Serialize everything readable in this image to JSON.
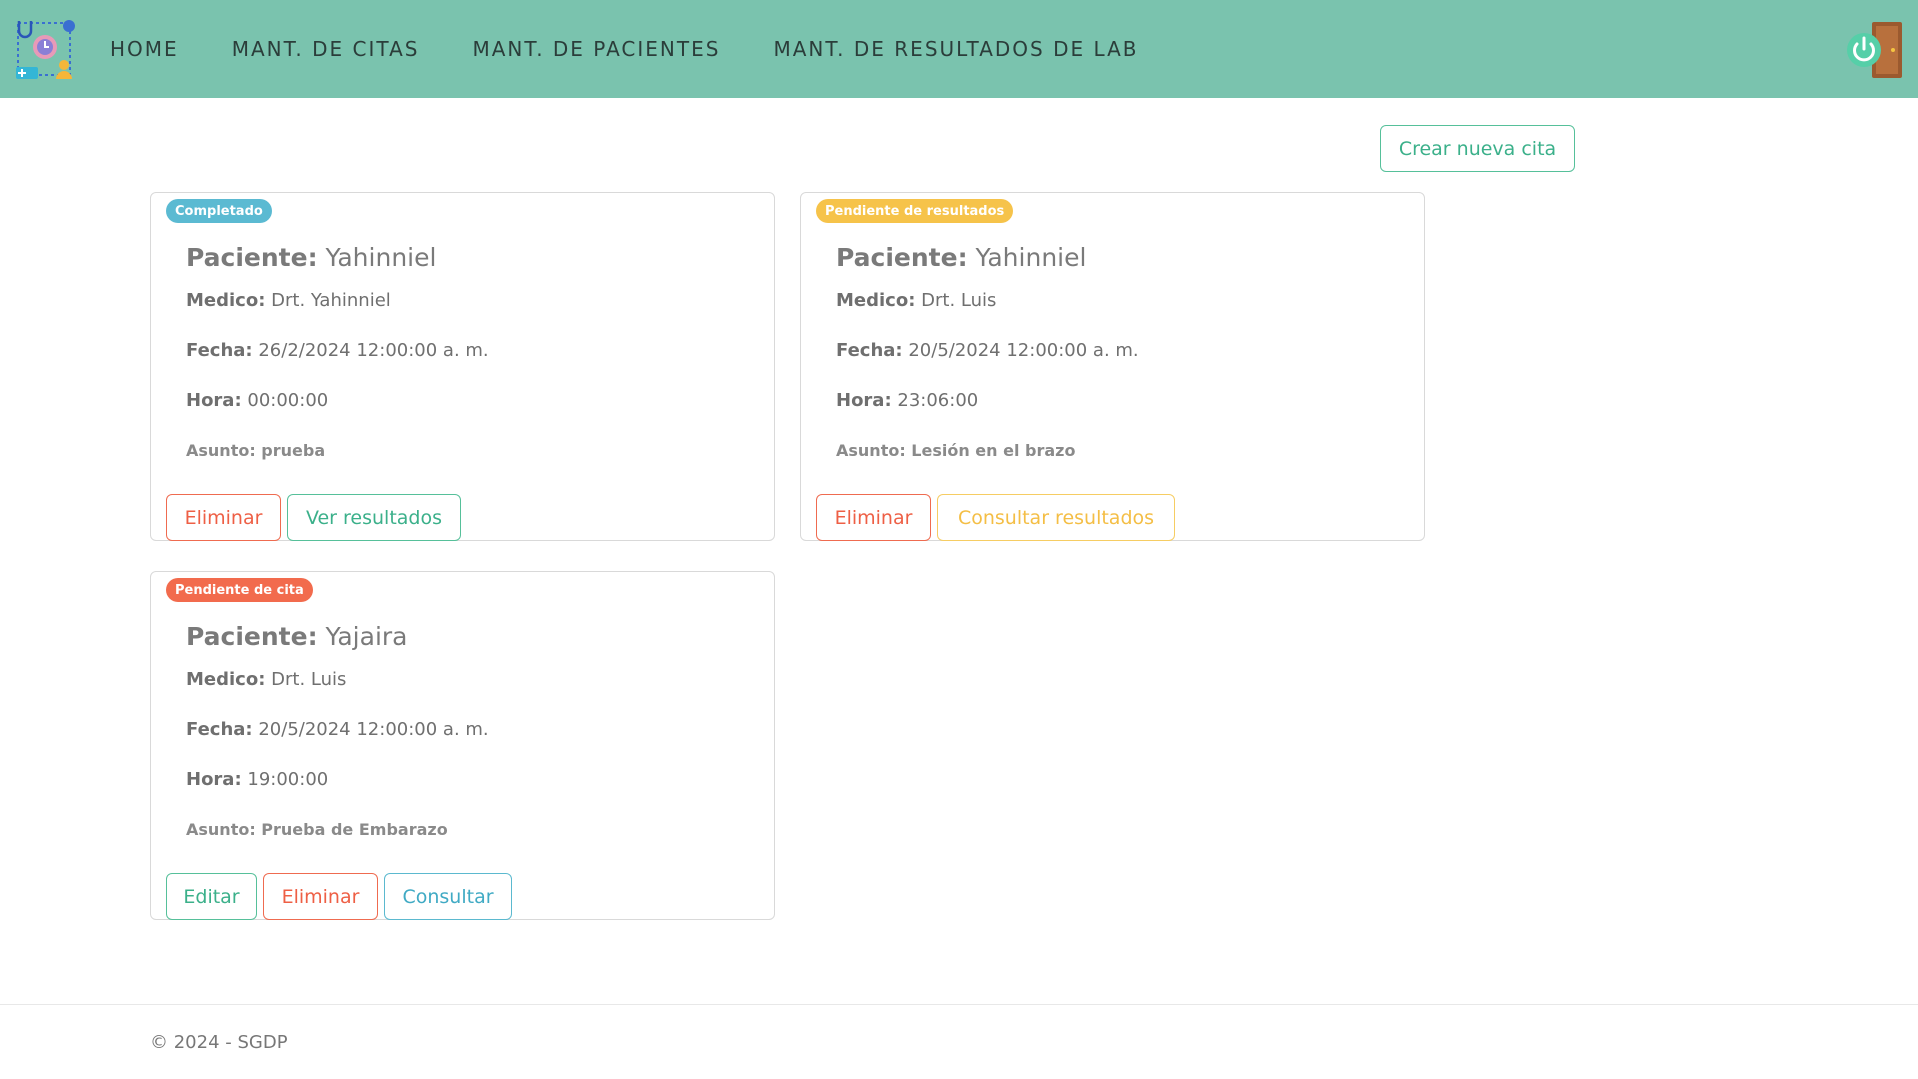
{
  "nav": {
    "items": [
      {
        "label": "HOME"
      },
      {
        "label": "MANT. DE CITAS"
      },
      {
        "label": "MANT. DE PACIENTES"
      },
      {
        "label": "MANT. DE RESULTADOS DE LAB"
      }
    ]
  },
  "actions": {
    "create_label": "Crear nueva cita"
  },
  "labels": {
    "patient": "Paciente:",
    "doctor": "Medico:",
    "date": "Fecha:",
    "time": "Hora:"
  },
  "appointments": [
    {
      "status": "Completado",
      "patient": "Yahinniel",
      "doctor": "Drt. Yahinniel",
      "date": "26/2/2024 12:00:00 a. m.",
      "time": "00:00:00",
      "subject": "Asunto: prueba",
      "buttons": [
        "Eliminar",
        "Ver resultados"
      ]
    },
    {
      "status": "Pendiente de resultados",
      "patient": "Yahinniel",
      "doctor": "Drt. Luis",
      "date": "20/5/2024 12:00:00 a. m.",
      "time": "23:06:00",
      "subject": "Asunto: Lesión en el brazo",
      "buttons": [
        "Eliminar",
        "Consultar resultados"
      ]
    },
    {
      "status": "Pendiente de cita",
      "patient": "Yajaira",
      "doctor": "Drt. Luis",
      "date": "20/5/2024 12:00:00 a. m.",
      "time": "19:00:00",
      "subject": "Asunto: Prueba de Embarazo",
      "buttons": [
        "Editar",
        "Eliminar",
        "Consultar"
      ]
    }
  ],
  "footer": {
    "text": "© 2024 - SGDP"
  },
  "colors": {
    "navbar": "#7ac3ae",
    "success": "#56c09a",
    "danger": "#ef6b50",
    "warning": "#f6c34a",
    "info": "#5bbad2"
  },
  "icons": {
    "brand": "medical-logo-icon",
    "logout": "power-door-icon"
  }
}
